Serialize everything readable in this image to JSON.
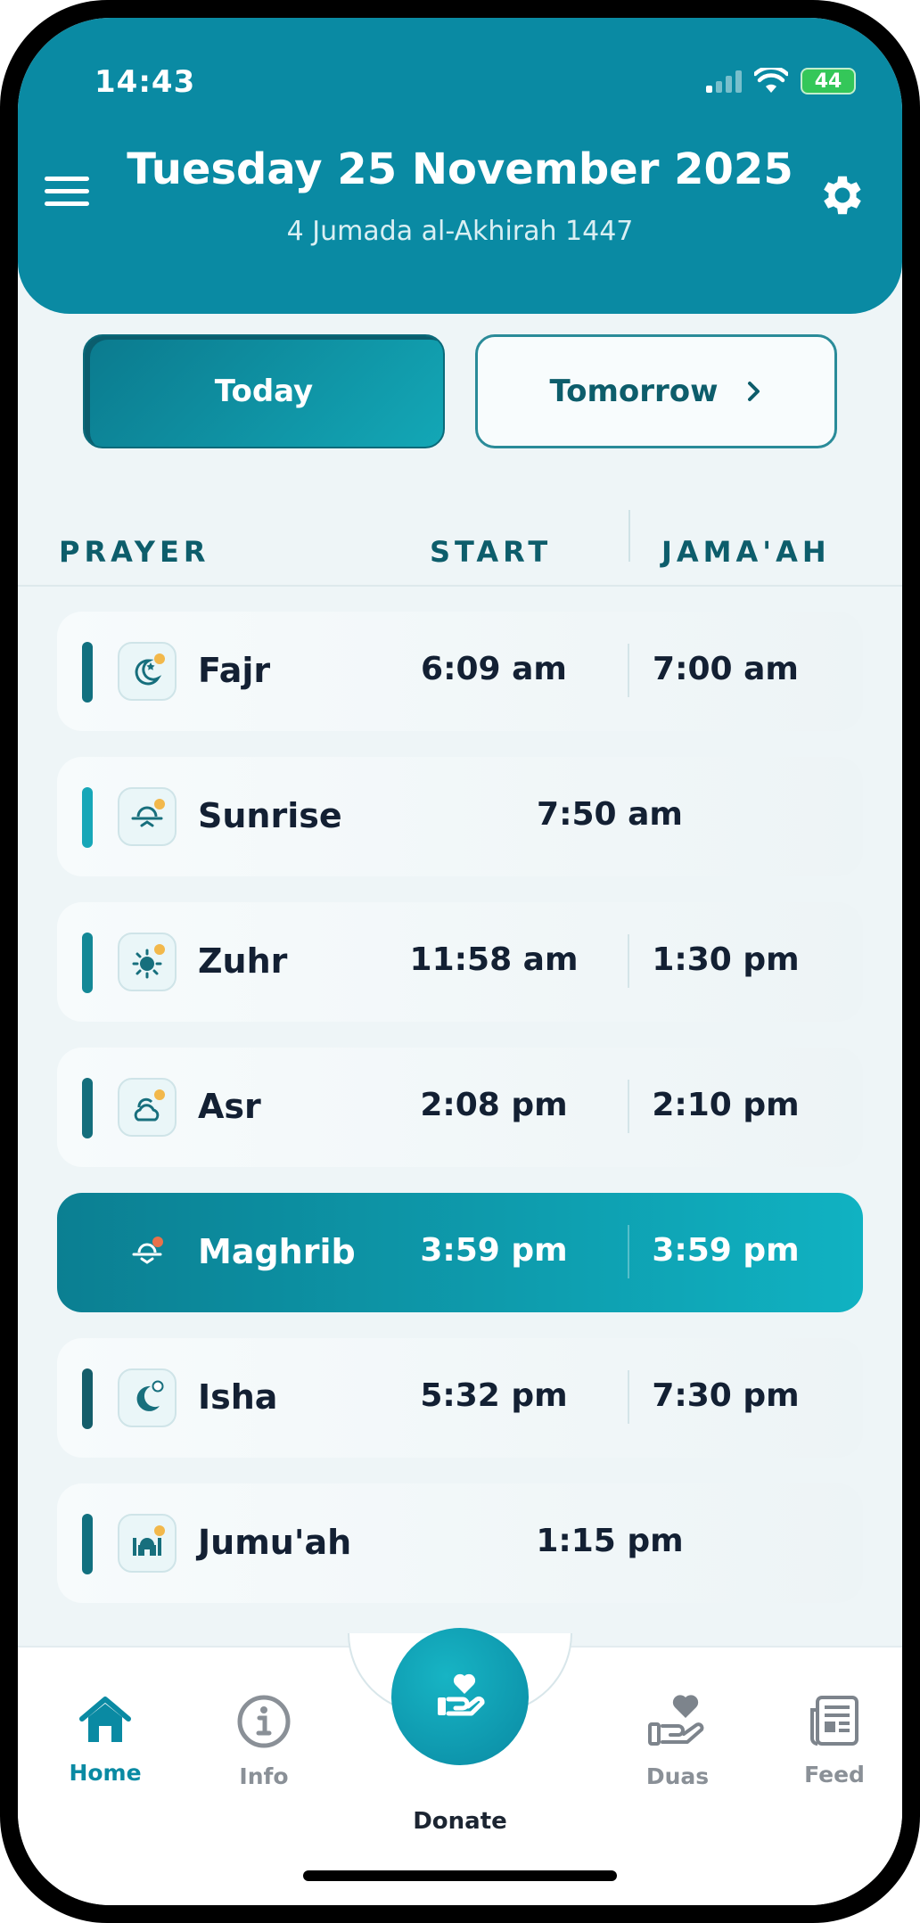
{
  "status_bar": {
    "time": "14:43",
    "battery": "44"
  },
  "header": {
    "date": "Tuesday 25 November 2025",
    "hijri_date": "4 Jumada al-Akhirah 1447"
  },
  "day_toggle": {
    "today_label": "Today",
    "tomorrow_label": "Tomorrow"
  },
  "table_header": {
    "prayer": "PRAYER",
    "start": "START",
    "jamaah": "JAMA'AH"
  },
  "prayers": [
    {
      "name": "Fajr",
      "start": "6:09 am",
      "jamaah": "7:00 am",
      "icon": "moon-star-icon"
    },
    {
      "name": "Sunrise",
      "time": "7:50 am",
      "icon": "sunrise-icon"
    },
    {
      "name": "Zuhr",
      "start": "11:58 am",
      "jamaah": "1:30 pm",
      "icon": "sun-icon"
    },
    {
      "name": "Asr",
      "start": "2:08 pm",
      "jamaah": "2:10 pm",
      "icon": "sun-cloud-icon"
    },
    {
      "name": "Maghrib",
      "start": "3:59 pm",
      "jamaah": "3:59 pm",
      "icon": "sunset-icon",
      "active": true
    },
    {
      "name": "Isha",
      "start": "5:32 pm",
      "jamaah": "7:30 pm",
      "icon": "crescent-moon-icon"
    },
    {
      "name": "Jumu'ah",
      "time": "1:15 pm",
      "icon": "mosque-icon"
    }
  ],
  "bottom_nav": {
    "home": "Home",
    "info": "Info",
    "donate": "Donate",
    "duas": "Duas",
    "feed": "Feed"
  },
  "colors": {
    "primary": "#0a8aa3",
    "active_row_start": "#0b7f92",
    "active_row_end": "#10b2c2",
    "text_dark": "#132033",
    "accent_dot": "#f2b84b"
  }
}
